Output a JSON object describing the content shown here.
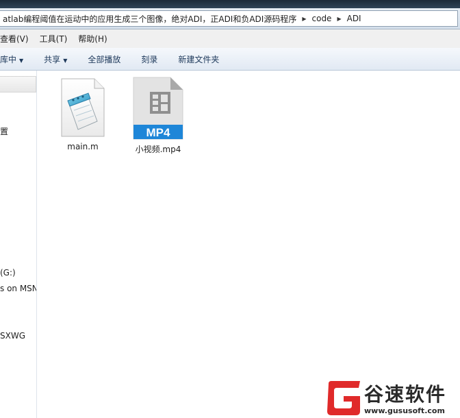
{
  "window": {
    "breadcrumbs": [
      "atlab编程阈值在运动中的应用生成三个图像，绝对ADI，正ADI和负ADI源码程序",
      "code",
      "ADI"
    ]
  },
  "menu": {
    "items": [
      "查看(V)",
      "工具(T)",
      "帮助(H)"
    ]
  },
  "toolbar": {
    "library_label": "库中",
    "share_label": "共享",
    "play_all_label": "全部播放",
    "burn_label": "刻录",
    "new_folder_label": "新建文件夹"
  },
  "nav": {
    "items": [
      "置",
      "(G:)",
      "s on MSN",
      "SXWG"
    ]
  },
  "files": [
    {
      "name": "main.m",
      "icon": "notepad-file-icon"
    },
    {
      "name": "小视频.mp4",
      "icon": "mp4-video-icon",
      "badge": "MP4"
    }
  ],
  "watermark": {
    "title": "谷速软件",
    "url": "www.gususoft.com"
  },
  "colors": {
    "mp4_badge": "#1e86d8",
    "watermark_red": "#e02a2a"
  }
}
